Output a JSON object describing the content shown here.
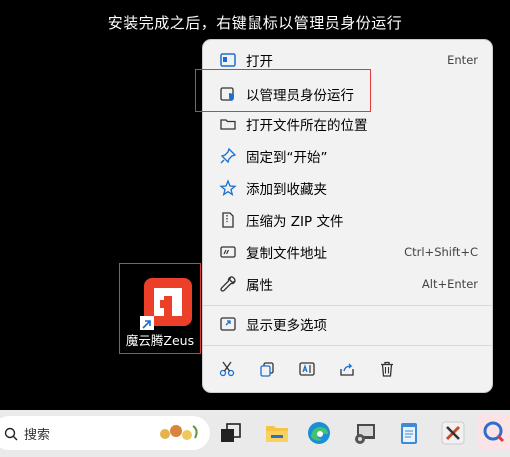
{
  "instruction": "安装完成之后，右键鼠标以管理员身份运行",
  "menu": {
    "items": [
      {
        "label": "打开",
        "shortcut": "Enter",
        "icon": "app-window-icon"
      },
      {
        "label": "以管理员身份运行",
        "shortcut": "",
        "icon": "admin-shield-icon"
      },
      {
        "label": "打开文件所在的位置",
        "shortcut": "",
        "icon": "folder-icon"
      },
      {
        "label": "固定到“开始”",
        "shortcut": "",
        "icon": "pin-icon"
      },
      {
        "label": "添加到收藏夹",
        "shortcut": "",
        "icon": "star-icon"
      },
      {
        "label": "压缩为 ZIP 文件",
        "shortcut": "",
        "icon": "zip-file-icon"
      },
      {
        "label": "复制文件地址",
        "shortcut": "Ctrl+Shift+C",
        "icon": "copy-path-icon"
      },
      {
        "label": "属性",
        "shortcut": "Alt+Enter",
        "icon": "wrench-icon"
      },
      {
        "label": "显示更多选项",
        "shortcut": "",
        "icon": "more-options-icon"
      }
    ],
    "actions": [
      "cut-icon",
      "copy-icon",
      "rename-icon",
      "share-icon",
      "delete-icon"
    ]
  },
  "desktop_shortcut": {
    "label": "魔云腾Zeus"
  },
  "taskbar": {
    "search_placeholder": "搜索"
  },
  "colors": {
    "highlight": "#e03a3a",
    "brand_red": "#ec3f2a",
    "icon_blue": "#1a6fd1"
  }
}
